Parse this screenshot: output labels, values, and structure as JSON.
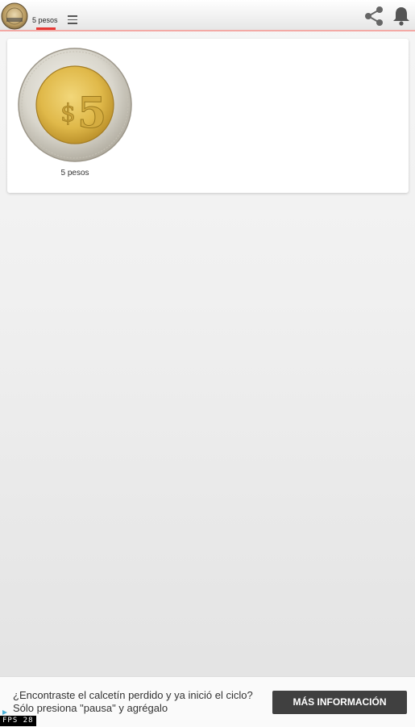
{
  "header": {
    "tab_label": "5 pesos",
    "accent_color": "#e53935",
    "icons": [
      "coin-logo-icon",
      "menu-icon",
      "share-icon",
      "bell-icon"
    ]
  },
  "grid": {
    "items": [
      {
        "caption": "5 pesos",
        "icon": "coin-5-pesos-icon"
      }
    ]
  },
  "coin": {
    "denomination": "5",
    "currency_symbol": "$"
  },
  "ad": {
    "text": "¿Encontraste el calcetín perdido y ya inició el ciclo? Sólo presiona \"pausa\" y agrégalo",
    "button_label": "MÁS INFORMACIÓN"
  },
  "debug": {
    "fps_label": "FPS 28"
  }
}
